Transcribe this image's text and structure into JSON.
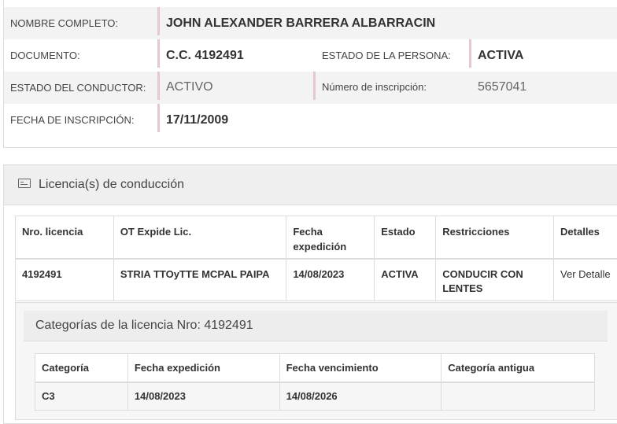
{
  "persona": {
    "nombre_label": "NOMBRE COMPLETO:",
    "nombre_value": "JOHN ALEXANDER BARRERA ALBARRACIN",
    "documento_label": "DOCUMENTO:",
    "documento_value": "C.C. 4192491",
    "estado_persona_label": "ESTADO DE LA PERSONA:",
    "estado_persona_value": "ACTIVA",
    "estado_conductor_label": "ESTADO DEL CONDUCTOR:",
    "estado_conductor_value": "ACTIVO",
    "numero_inscripcion_label": "Número de inscripción:",
    "numero_inscripcion_value": "5657041",
    "fecha_inscripcion_label": "FECHA DE INSCRIPCIÓN:",
    "fecha_inscripcion_value": "17/11/2009"
  },
  "licencias": {
    "title": "Licencia(s) de conducción",
    "icon": "id-card-icon",
    "columns": [
      "Nro. licencia",
      "OT Expide Lic.",
      "Fecha expedición",
      "Estado",
      "Restricciones",
      "Detalles"
    ],
    "rows": [
      {
        "nro": "4192491",
        "ot": "STRIA TTOyTTE MCPAL PAIPA",
        "fecha": "14/08/2023",
        "estado": "ACTIVA",
        "restricciones": "CONDUCIR CON LENTES",
        "detalles": "Ver Detalle"
      }
    ]
  },
  "categorias": {
    "title": "Categorías de la licencia Nro: 4192491",
    "columns": [
      "Categoría",
      "Fecha expedición",
      "Fecha vencimiento",
      "Categoría antigua"
    ],
    "rows": [
      {
        "categoria": "C3",
        "expedicion": "14/08/2023",
        "vencimiento": "14/08/2026",
        "antigua": ""
      }
    ]
  }
}
